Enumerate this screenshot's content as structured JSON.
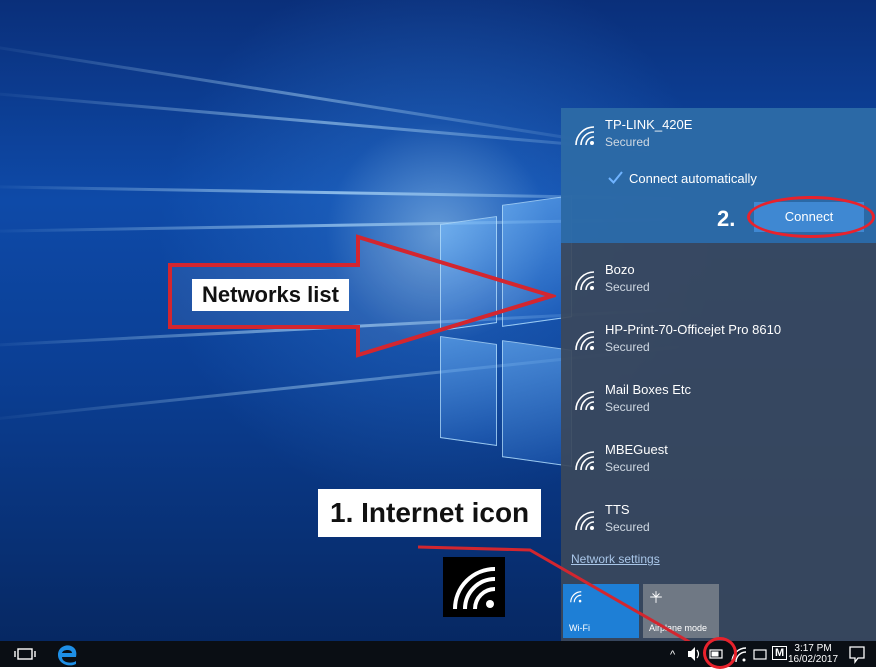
{
  "flyout": {
    "selected_network": {
      "name": "TP-LINK_420E",
      "status": "Secured"
    },
    "connect_automatically": {
      "label": "Connect automatically",
      "checked": true
    },
    "connect_button": "Connect",
    "networks": [
      {
        "name": "Bozo",
        "status": "Secured"
      },
      {
        "name": "HP-Print-70-Officejet Pro 8610",
        "status": "Secured"
      },
      {
        "name": "Mail Boxes Etc",
        "status": "Secured"
      },
      {
        "name": "MBEGuest",
        "status": "Secured"
      },
      {
        "name": "TTS",
        "status": "Secured"
      }
    ],
    "network_settings": "Network settings",
    "quick_actions": [
      {
        "label": "Wi-Fi",
        "icon": "wifi-icon",
        "active": true
      },
      {
        "label": "Airplane mode",
        "icon": "airplane-icon",
        "active": false
      }
    ]
  },
  "annotations": {
    "networks_list": "Networks list",
    "internet_icon": "1. Internet icon",
    "step2": "2."
  },
  "taskbar": {
    "time": "3:17 PM",
    "date": "16/02/2017",
    "tray_letter": "M"
  },
  "colors": {
    "accent": "#3f88d2",
    "highlight_ring": "#e8222c",
    "flyout_bg": "#3a485c"
  }
}
